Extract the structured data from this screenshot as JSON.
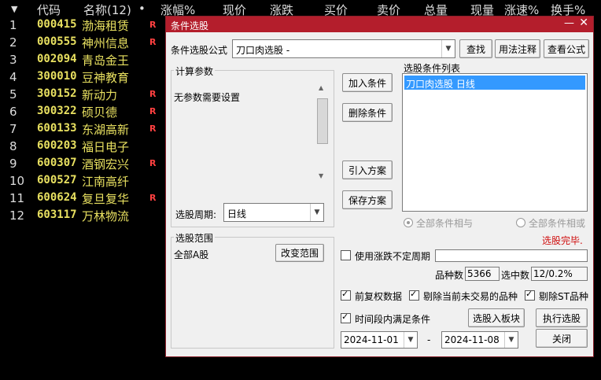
{
  "table": {
    "sort_arrow": "▼",
    "headers": {
      "code": "代码",
      "name": "名称(12)",
      "dot": "•",
      "change_pct": "涨幅%",
      "price": "现价",
      "change": "涨跌",
      "bid": "买价",
      "ask": "卖价",
      "volume": "总量",
      "cur_volume": "现量",
      "speed": "涨速%",
      "turnover": "换手%"
    },
    "rows": [
      {
        "idx": "1",
        "code": "000415",
        "name": "渤海租赁",
        "flag": "R"
      },
      {
        "idx": "2",
        "code": "000555",
        "name": "神州信息",
        "flag": "R"
      },
      {
        "idx": "3",
        "code": "002094",
        "name": "青岛金王",
        "flag": ""
      },
      {
        "idx": "4",
        "code": "300010",
        "name": "豆神教育",
        "flag": ""
      },
      {
        "idx": "5",
        "code": "300152",
        "name": "新动力",
        "flag": "R"
      },
      {
        "idx": "6",
        "code": "300322",
        "name": "硕贝德",
        "flag": "R"
      },
      {
        "idx": "7",
        "code": "600133",
        "name": "东湖高新",
        "flag": "R"
      },
      {
        "idx": "8",
        "code": "600203",
        "name": "福日电子",
        "flag": ""
      },
      {
        "idx": "9",
        "code": "600307",
        "name": "酒钢宏兴",
        "flag": "R"
      },
      {
        "idx": "10",
        "code": "600527",
        "name": "江南高纤",
        "flag": ""
      },
      {
        "idx": "11",
        "code": "600624",
        "name": "复旦复华",
        "flag": "R"
      },
      {
        "idx": "12",
        "code": "603117",
        "name": "万林物流",
        "flag": ""
      }
    ]
  },
  "dialog": {
    "title": "条件选股",
    "minimize": "—",
    "close": "✕",
    "formula_label": "条件选股公式",
    "formula_value": "刀口肉选股  -",
    "btn_find": "查找",
    "btn_usage": "用法注释",
    "btn_view": "查看公式",
    "params_group": "计算参数",
    "params_text": "无参数需要设置",
    "period_label": "选股周期:",
    "period_value": "日线",
    "btn_add": "加入条件",
    "btn_delete": "删除条件",
    "btn_import": "引入方案",
    "btn_save": "保存方案",
    "cond_list_label": "选股条件列表",
    "cond_items": [
      "刀口肉选股  日线"
    ],
    "radio_and": "全部条件相与",
    "radio_or": "全部条件相或",
    "status": "选股完毕.",
    "range_group": "选股范围",
    "range_value": "全部A股",
    "btn_change_range": "改变范围",
    "chk_uncertain": "使用涨跌不定周期",
    "count_label": "品种数",
    "count_value": "5366",
    "selected_label": "选中数",
    "selected_value": "12/0.2%",
    "chk_adjusted": "前复权数据",
    "chk_exclude_untraded": "剔除当前未交易的品种",
    "chk_exclude_st": "剔除ST品种",
    "chk_period": "时间段内满足条件",
    "btn_to_block": "选股入板块",
    "btn_execute": "执行选股",
    "date_start": "2024-11-01",
    "date_sep": "-",
    "date_end": "2024-11-08",
    "btn_close": "关闭"
  },
  "colors": {
    "title_bg": "#b41e2c",
    "stock_text": "#e8e060",
    "flag": "#ff4040",
    "status": "#d01010",
    "selection": "#3399ff"
  }
}
